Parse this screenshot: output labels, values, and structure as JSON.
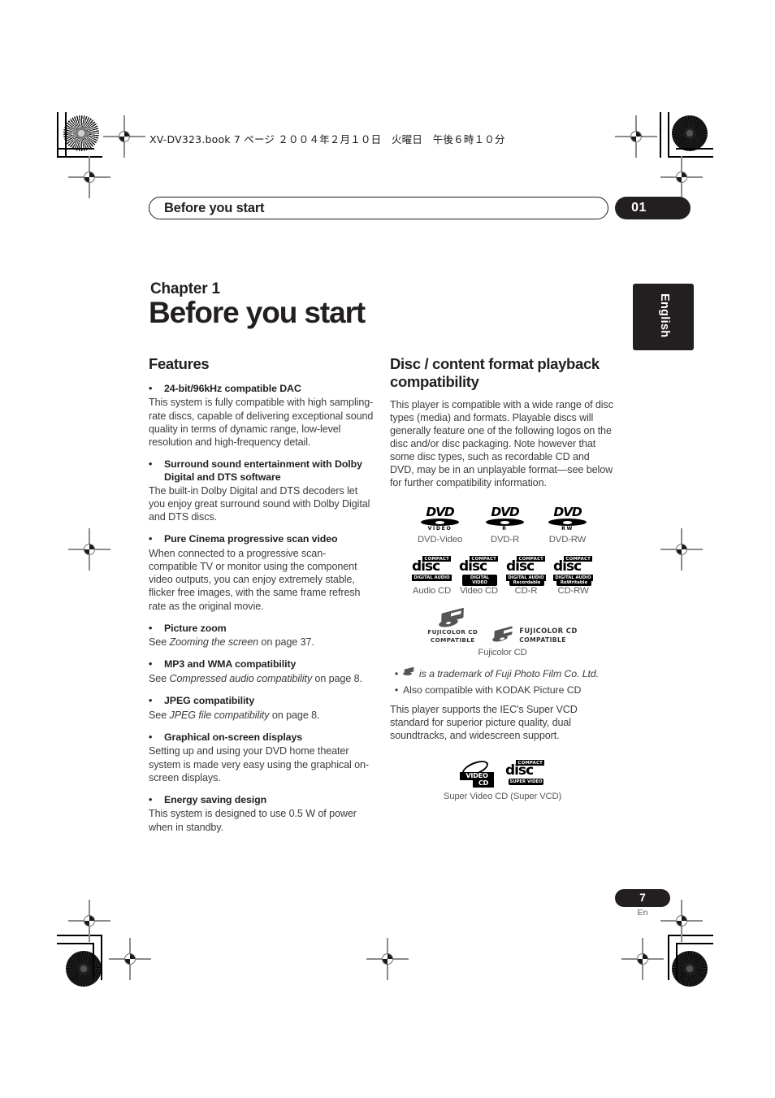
{
  "printer_marks": {
    "file_header": "XV-DV323.book  7 ページ  ２００４年２月１０日　火曜日　午後６時１０分"
  },
  "running_head": {
    "title": "Before you start",
    "chapter_number": "01"
  },
  "chapter": {
    "label": "Chapter 1",
    "title": "Before you start",
    "language_tab": "English"
  },
  "left_column": {
    "heading": "Features",
    "items": [
      {
        "bullet": "•",
        "title": "24-bit/96kHz compatible DAC",
        "body": "This system is fully compatible with high sampling-rate discs, capable of delivering exceptional sound quality in terms of dynamic range, low-level resolution and high-frequency detail."
      },
      {
        "bullet": "•",
        "title": "Surround sound entertainment with Dolby Digital and DTS software",
        "body": "The built-in Dolby Digital and DTS decoders let you enjoy great surround sound with Dolby Digital and DTS discs."
      },
      {
        "bullet": "•",
        "title": "Pure Cinema progressive scan video",
        "body": "When connected to a progressive scan-compatible TV or monitor using the component video outputs, you can enjoy extremely stable, flicker free images, with the same frame refresh rate as the original movie."
      },
      {
        "bullet": "•",
        "title": "Picture zoom",
        "body_pre": "See ",
        "body_em": "Zooming the screen",
        "body_post": " on page 37."
      },
      {
        "bullet": "•",
        "title": "MP3 and WMA compatibility",
        "body_pre": "See ",
        "body_em": "Compressed audio compatibility",
        "body_post": " on page 8."
      },
      {
        "bullet": "•",
        "title": "JPEG compatibility",
        "body_pre": "See ",
        "body_em": "JPEG file compatibility",
        "body_post": " on page 8."
      },
      {
        "bullet": "•",
        "title": "Graphical on-screen displays",
        "body": "Setting up and using your DVD home theater system is made very easy using the graphical on-screen displays."
      },
      {
        "bullet": "•",
        "title": "Energy saving design",
        "body": "This system is designed to use 0.5 W of power when in standby."
      }
    ]
  },
  "right_column": {
    "heading": "Disc / content format playback compatibility",
    "intro": "This player is compatible with a wide range of disc types (media) and formats. Playable discs will generally feature one of the following logos on the disc and/or disc packaging. Note however that some disc types, such as recordable CD and DVD, may be in an unplayable format—see below for further compatibility information.",
    "dvd_logos": [
      {
        "mark": "DVD",
        "sub": "VIDEO",
        "caption": "DVD-Video"
      },
      {
        "mark": "DVD",
        "sub": "R",
        "caption": "DVD-R"
      },
      {
        "mark": "DVD",
        "sub": "RW",
        "caption": "DVD-RW"
      }
    ],
    "cd_logos": [
      {
        "top": "COMPACT",
        "mark": "disc",
        "line1": "DIGITAL AUDIO",
        "line2": "",
        "caption": "Audio CD"
      },
      {
        "top": "COMPACT",
        "mark": "disc",
        "line1": "DIGITAL VIDEO",
        "line2": "",
        "caption": "Video CD"
      },
      {
        "top": "COMPACT",
        "mark": "disc",
        "line1": "DIGITAL AUDIO",
        "line2": "Recordable",
        "caption": "CD-R"
      },
      {
        "top": "COMPACT",
        "mark": "disc",
        "line1": "DIGITAL AUDIO",
        "line2": "ReWritable",
        "caption": "CD-RW"
      }
    ],
    "fuji_logos": [
      {
        "line1": "FUJICOLOR CD",
        "line2": "COMPATIBLE"
      },
      {
        "line1": "FUJICOLOR CD",
        "line2": "COMPATIBLE"
      }
    ],
    "fuji_caption": "Fujicolor CD",
    "trademark_bullets": [
      {
        "bullet": "•",
        "glyph": "fuji-mark",
        "text": "is a trademark of Fuji Photo Film Co. Ltd."
      },
      {
        "bullet": "•",
        "text": "Also compatible with KODAK Picture CD"
      }
    ],
    "svcd_paragraph": "This player supports the IEC's Super VCD standard for superior picture quality, dual soundtracks, and widescreen support.",
    "svcd_logos": [
      {
        "mark": "VIDEO",
        "mark2": "CD"
      },
      {
        "top": "COMPACT",
        "mark": "disc",
        "line2": "SUPER VIDEO"
      }
    ],
    "svcd_caption": "Super Video CD (Super VCD)"
  },
  "footer": {
    "page_number": "7",
    "language_code": "En"
  }
}
